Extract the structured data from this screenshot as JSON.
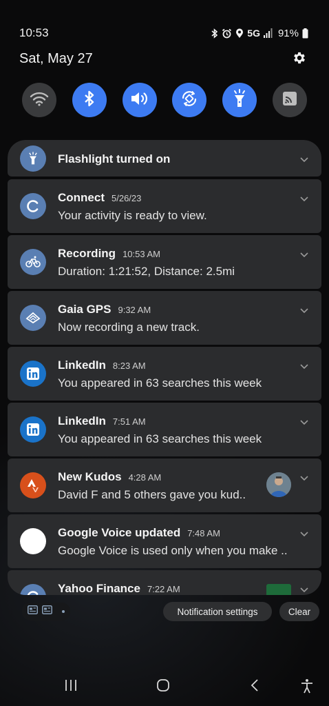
{
  "status": {
    "time": "10:53",
    "network": "5G",
    "battery": "91%",
    "icons": [
      "bluetooth-icon",
      "alarm-icon",
      "location-icon",
      "signal-icon",
      "battery-icon"
    ]
  },
  "header": {
    "date": "Sat, May 27",
    "settings_icon": "gear-icon"
  },
  "quick_settings": [
    {
      "name": "wifi",
      "state": "off",
      "icon": "wifi-icon"
    },
    {
      "name": "bluetooth",
      "state": "on",
      "icon": "bluetooth-icon"
    },
    {
      "name": "sound",
      "state": "on",
      "icon": "speaker-icon"
    },
    {
      "name": "auto-rotate",
      "state": "on",
      "icon": "rotate-icon"
    },
    {
      "name": "flashlight",
      "state": "on",
      "icon": "flashlight-icon"
    },
    {
      "name": "cast",
      "state": "off",
      "icon": "cast-icon"
    }
  ],
  "notifications": [
    {
      "app": "Flashlight turned on"
    },
    {
      "app": "Connect",
      "time": "5/26/23",
      "body": "Your activity is ready to view."
    },
    {
      "app": "Recording",
      "time": "10:53 AM",
      "body": "Duration: 1:21:52, Distance: 2.5mi"
    },
    {
      "app": "Gaia GPS",
      "time": "9:32 AM",
      "body": "Now recording a new track."
    },
    {
      "app": "LinkedIn",
      "time": "8:23 AM",
      "body": "You appeared in 63 searches this week"
    },
    {
      "app": "LinkedIn",
      "time": "7:51 AM",
      "body": "You appeared in 63 searches this week"
    },
    {
      "app": "New Kudos",
      "time": "4:28 AM",
      "body": "David F and 5 others gave you kud.."
    },
    {
      "app": "Google Voice updated",
      "time": "7:48 AM",
      "body": "Google Voice is used only when you make .."
    },
    {
      "app": "Yahoo Finance",
      "time": "7:22 AM",
      "body": ""
    }
  ],
  "bottom": {
    "settings_label": "Notification settings",
    "clear_label": "Clear"
  },
  "colors": {
    "accent": "#3d7bf2",
    "card": "#2b2c2e",
    "linkedin": "#0a66c2",
    "strava": "#d8501b"
  }
}
